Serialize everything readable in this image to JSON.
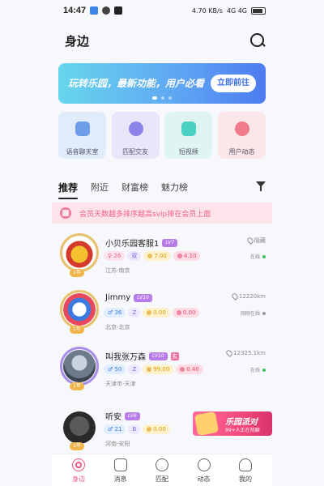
{
  "status_bar": {
    "time": "14:47",
    "speed": "4.70 KB/s",
    "network": "4G 4G"
  },
  "header": {
    "title": "身边"
  },
  "banner": {
    "text": "玩转乐园，最新功能，用户必看",
    "button_label": "立即前往"
  },
  "tiles": [
    {
      "label": "语音聊天室",
      "icon": "microphone-icon"
    },
    {
      "label": "匹配交友",
      "icon": "people-icon"
    },
    {
      "label": "短视频",
      "icon": "video-icon"
    },
    {
      "label": "用户动态",
      "icon": "activity-icon"
    }
  ],
  "tabs": [
    "推荐",
    "附近",
    "财富榜",
    "魅力榜"
  ],
  "notice": {
    "text": "会员天数越多排序越高svip排在会员上面"
  },
  "users": [
    {
      "name": "小贝乐园客服1",
      "level": "LV7",
      "gender": "♀",
      "age": "26",
      "zodiac": "双",
      "wealth": "7.00",
      "charm": "4.10",
      "location": "江苏-南京",
      "distance": "隐藏",
      "status": "在线",
      "vip": "1年"
    },
    {
      "name": "Jimmy",
      "level": "LV10",
      "gender": "♂",
      "age": "36",
      "zodiac": "Z",
      "wealth": "0.00",
      "charm": "0.00",
      "location": "北京-北京",
      "distance": "12220km",
      "status": "刚刚在线",
      "vip": "1年"
    },
    {
      "name": "叫我张万森",
      "level": "LV10",
      "badge": "实",
      "gender": "♂",
      "age": "50",
      "zodiac": "Z",
      "wealth": "99.00",
      "charm": "0.40",
      "location": "天津市-天津",
      "distance": "12325.1km",
      "status": "在线",
      "vip": "1年"
    },
    {
      "name": "听安",
      "level": "LV6",
      "gender": "♂",
      "age": "21",
      "zodiac": "B",
      "wealth": "0.00",
      "charm": "",
      "location": "河南-安阳",
      "distance": "",
      "status": "",
      "vip": "1年"
    }
  ],
  "promo": {
    "title": "乐园派对",
    "subtitle": "99+人正在热聊"
  },
  "bottom_nav": [
    "身边",
    "消息",
    "匹配",
    "动态",
    "我的"
  ]
}
